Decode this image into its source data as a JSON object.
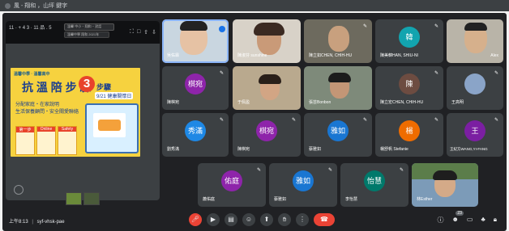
{
  "window": {
    "title": "風 - 翔和 ，山坪 鍵字"
  },
  "presentation": {
    "top_left_label": "11 · + 4 3 · 11 品 . 5",
    "center_url_line1": "溫馨 中小 ~ 翔和 ~ 對話",
    "center_url_line2": "溫馨中學 翔和 2021年 ",
    "right_icons": [
      "⛶",
      "□",
      "⇧",
      "⇩"
    ],
    "slide": {
      "org": "溫馨中學 · 溫馨高中",
      "title": "抗 溫 陪 步 驟",
      "number": "3",
      "title2": "步驟",
      "date": "9/21 健康關懷日",
      "sub": [
        "分配家庭・在家說明",
        "生活保養顧問・安全關愛聯絡"
      ],
      "tiles": [
        "第一步",
        "Online",
        "Safety"
      ]
    }
  },
  "participants": [
    {
      "name": "吳佑霖",
      "color": "#1a73e8",
      "initials": ""
    },
    {
      "name": "陳淑芬 sunshine",
      "color": "#a0522d",
      "initials": ""
    },
    {
      "name": "陳立如CHEN, CHIH-HU",
      "color": "#5f6368",
      "initials": ""
    },
    {
      "name": "陳美韓HAN, SHIU-NI",
      "color": "#12a4af",
      "initials": "韓"
    },
    {
      "name": "Alex",
      "color": "#5f6368",
      "initials": ""
    },
    {
      "name": "陳棋宛",
      "color": "#8e24aa",
      "initials": "棋宛"
    },
    {
      "name": "于佩盈",
      "color": "#5f6368",
      "initials": ""
    },
    {
      "name": "張芸Bonbon",
      "color": "#5f6368",
      "initials": ""
    },
    {
      "name": "陳立宏CHEN, CHIH-HU",
      "color": "#6d4c41",
      "initials": "陳"
    },
    {
      "name": "王高明",
      "color": "#5f6368",
      "initials": ""
    },
    {
      "name": "劉秀滿",
      "color": "#1e88e5",
      "initials": "秀滿"
    },
    {
      "name": "陳棋宛",
      "color": "#8e24aa",
      "initials": "棋宛"
    },
    {
      "name": "蔡雅如",
      "color": "#1976d2",
      "initials": "雅如"
    },
    {
      "name": "楊舒帆 Stefanie",
      "color": "#ef6c00",
      "initials": "楊"
    },
    {
      "name": "王紀方WANG,YI-FANG",
      "color": "#7b1fa2",
      "initials": "王"
    },
    {
      "name": "蕭佑庭",
      "color": "#8e24aa",
      "initials": "佑庭"
    },
    {
      "name": "蔡雅如",
      "color": "#1976d2",
      "initials": "雅如"
    },
    {
      "name": "李怡慧",
      "color": "#00796b",
      "initials": "怡慧"
    },
    {
      "name": "林Esther",
      "color": "#5f6368",
      "initials": ""
    }
  ],
  "bottom_bar": {
    "time": "上午8:13",
    "separator": "|",
    "meeting_code": "syf-vhsk-pae",
    "participant_count": "23"
  }
}
